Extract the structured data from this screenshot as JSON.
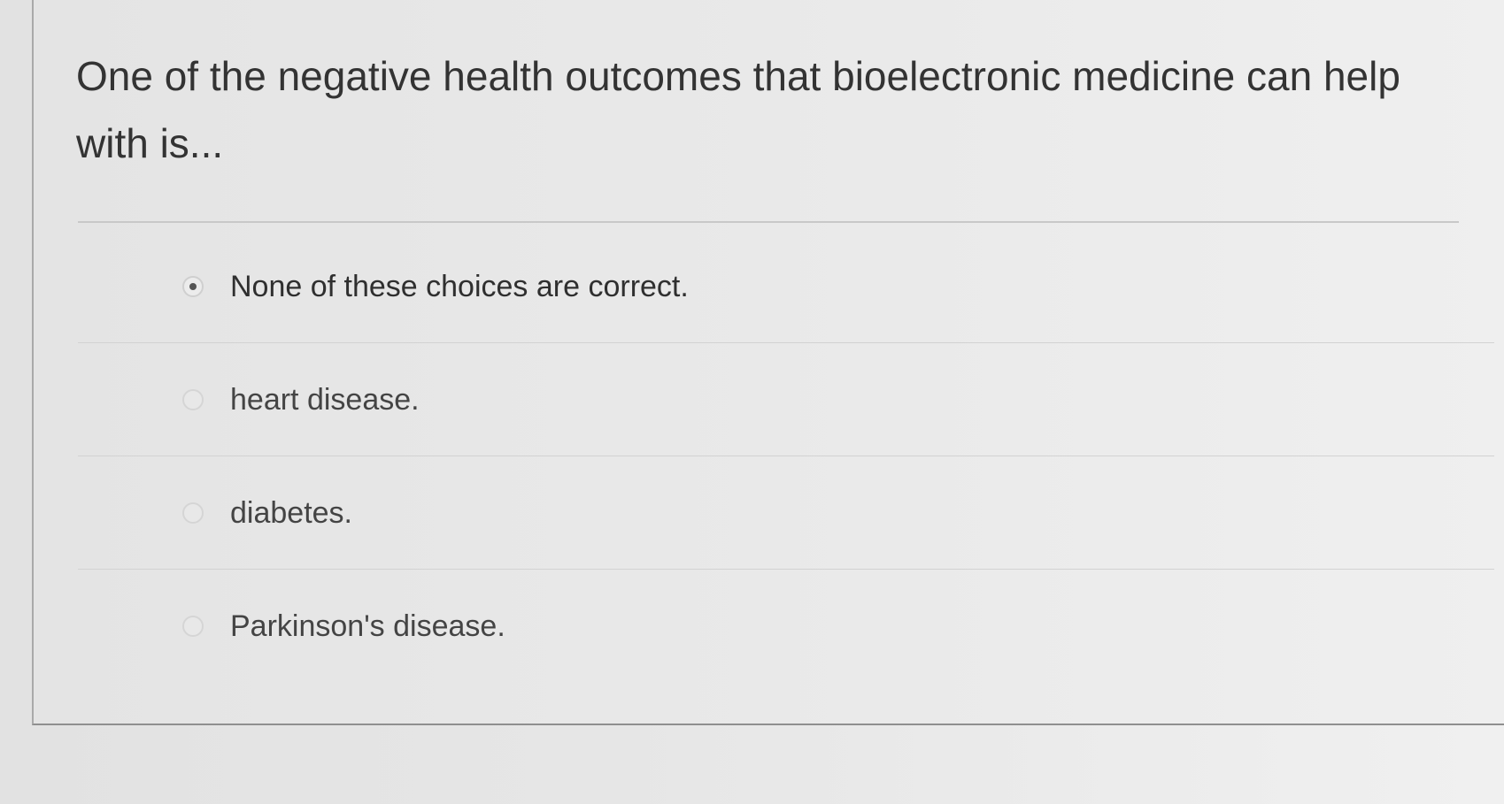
{
  "question": {
    "text": "One of the negative health outcomes that bioelectronic medicine can help with is..."
  },
  "answers": [
    {
      "label": "None of these choices are correct.",
      "selected": true
    },
    {
      "label": "heart disease.",
      "selected": false
    },
    {
      "label": "diabetes.",
      "selected": false
    },
    {
      "label": "Parkinson's disease.",
      "selected": false
    }
  ]
}
